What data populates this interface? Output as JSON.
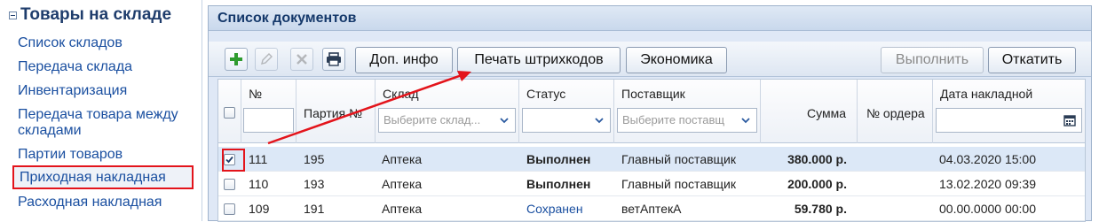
{
  "sidebar": {
    "title": "Товары на складе",
    "items": [
      {
        "label": "Список складов"
      },
      {
        "label": "Передача склада"
      },
      {
        "label": "Инвентаризация"
      },
      {
        "label": "Передача товара между"
      },
      {
        "label": "складами"
      },
      {
        "label": "Партии товаров"
      },
      {
        "label": "Приходная накладная"
      },
      {
        "label": "Расходная накладная"
      }
    ]
  },
  "panel": {
    "title": "Список документов"
  },
  "toolbar": {
    "add_icon": "plus-icon",
    "edit_icon": "pencil-icon",
    "delete_icon": "close-icon",
    "print_icon": "printer-icon",
    "extra_info_label": "Доп. инфо",
    "print_barcodes_label": "Печать штрихкодов",
    "economics_label": "Экономика",
    "execute_label": "Выполнить",
    "rollback_label": "Откатить"
  },
  "grid": {
    "columns": {
      "number": "№",
      "batch": "Партия №",
      "warehouse": "Склад",
      "status": "Статус",
      "supplier": "Поставщик",
      "sum": "Сумма",
      "order_number": "№ ордера",
      "invoice_date": "Дата накладной"
    },
    "filters": {
      "warehouse_placeholder": "Выберите склад...",
      "supplier_placeholder": "Выберите поставщ"
    },
    "rows": [
      {
        "checked": true,
        "number": "111",
        "batch": "195",
        "warehouse": "Аптека",
        "status": "Выполнен",
        "supplier": "Главный поставщик",
        "sum": "380.000 р.",
        "order": "",
        "date": "04.03.2020 15:00"
      },
      {
        "checked": false,
        "number": "110",
        "batch": "193",
        "warehouse": "Аптека",
        "status": "Выполнен",
        "supplier": "Главный поставщик",
        "sum": "200.000 р.",
        "order": "",
        "date": "13.02.2020 09:39"
      },
      {
        "checked": false,
        "number": "109",
        "batch": "191",
        "warehouse": "Аптека",
        "status": "Сохранен",
        "supplier": "ветАптекА",
        "sum": "59.780 р.",
        "order": "",
        "date": "00.00.0000 00:00"
      }
    ]
  },
  "colors": {
    "accent_red": "#e3141b",
    "link_blue": "#1a4fa0",
    "add_green": "#2e9b2e"
  }
}
